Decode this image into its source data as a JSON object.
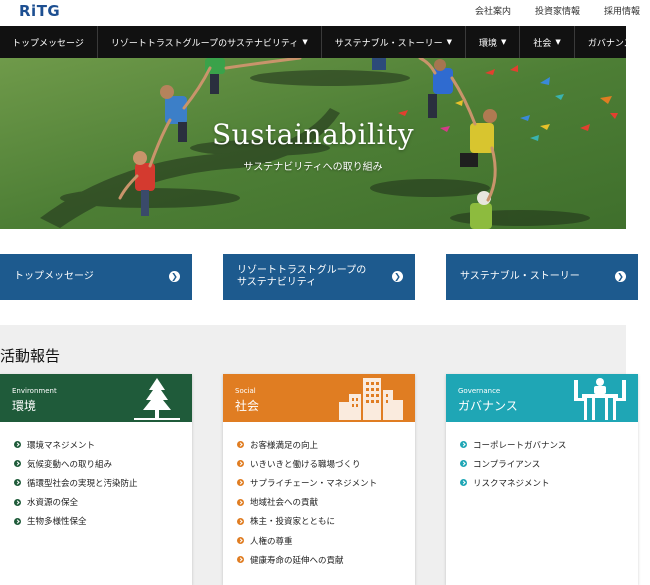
{
  "header": {
    "logo_text": "RiTG",
    "util_links": [
      "会社案内",
      "投資家情報",
      "採用情報"
    ]
  },
  "nav": {
    "items": [
      {
        "label": "トップメッセージ",
        "dropdown": false
      },
      {
        "label": "リゾートトラストグループのサステナビリティ",
        "dropdown": true
      },
      {
        "label": "サステナブル・ストーリー",
        "dropdown": true
      },
      {
        "label": "環境",
        "dropdown": true
      },
      {
        "label": "社会",
        "dropdown": true
      },
      {
        "label": "ガバナンス",
        "dropdown": true
      }
    ]
  },
  "hero": {
    "title": "Sustainability",
    "subtitle": "サステナビリティへの取り組み"
  },
  "cta": {
    "buttons": [
      {
        "label_line1": "トップメッセージ",
        "label_line2": ""
      },
      {
        "label_line1": "リゾートトラストグループの",
        "label_line2": "サステナビリティ"
      },
      {
        "label_line1": "サステナブル・ストーリー",
        "label_line2": ""
      }
    ]
  },
  "report": {
    "heading": "活動報告",
    "cards": [
      {
        "en": "Environment",
        "jp": "環境",
        "color": "#1f5b3a",
        "icon": "tree-icon",
        "items": [
          "環境マネジメント",
          "気候変動への取り組み",
          "循環型社会の実現と汚染防止",
          "水資源の保全",
          "生物多様性保全"
        ]
      },
      {
        "en": "Social",
        "jp": "社会",
        "color": "#e07d22",
        "icon": "building-icon",
        "items": [
          "お客様満足の向上",
          "いきいきと働ける職場づくり",
          "サプライチェーン・マネジメント",
          "地域社会への貢献",
          "株主・投資家とともに",
          "人権の尊重",
          "健康寿命の延伸への貢献"
        ]
      },
      {
        "en": "Governance",
        "jp": "ガバナンス",
        "color": "#1fa6b5",
        "icon": "meeting-icon",
        "items": [
          "コーポレートガバナンス",
          "コンプライアンス",
          "リスクマネジメント"
        ]
      }
    ]
  }
}
